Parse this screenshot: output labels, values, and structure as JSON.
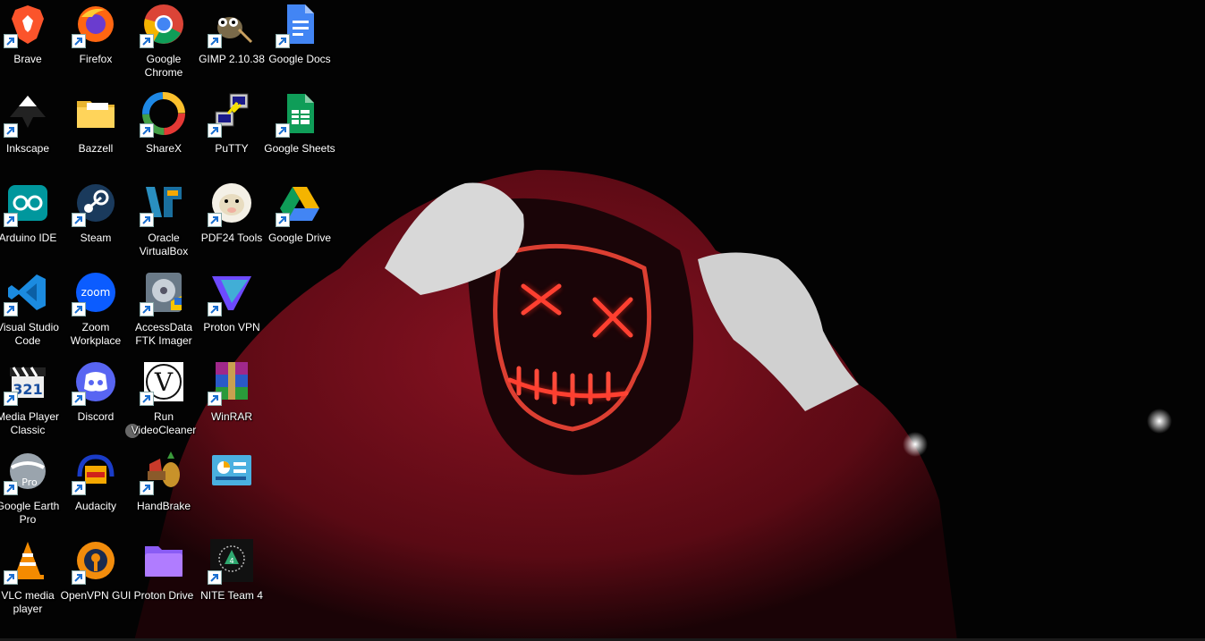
{
  "desktop": {
    "icons": [
      {
        "label": "Brave",
        "icon": "brave-icon",
        "shortcut": true
      },
      {
        "label": "Firefox",
        "icon": "firefox-icon",
        "shortcut": true
      },
      {
        "label": "Google Chrome",
        "icon": "chrome-icon",
        "shortcut": true
      },
      {
        "label": "GIMP 2.10.38",
        "icon": "gimp-icon",
        "shortcut": true
      },
      {
        "label": "Google Docs",
        "icon": "google-docs-icon",
        "shortcut": true
      },
      {
        "label": "Inkscape",
        "icon": "inkscape-icon",
        "shortcut": true
      },
      {
        "label": "Bazzell",
        "icon": "folder-icon",
        "shortcut": false
      },
      {
        "label": "ShareX",
        "icon": "sharex-icon",
        "shortcut": true
      },
      {
        "label": "PuTTY",
        "icon": "putty-icon",
        "shortcut": true
      },
      {
        "label": "Google Sheets",
        "icon": "google-sheets-icon",
        "shortcut": true
      },
      {
        "label": "Arduino IDE",
        "icon": "arduino-icon",
        "shortcut": true
      },
      {
        "label": "Steam",
        "icon": "steam-icon",
        "shortcut": true
      },
      {
        "label": "Oracle VirtualBox",
        "icon": "virtualbox-icon",
        "shortcut": true
      },
      {
        "label": "PDF24 Tools",
        "icon": "pdf24-icon",
        "shortcut": true
      },
      {
        "label": "Google Drive",
        "icon": "google-drive-icon",
        "shortcut": true
      },
      {
        "label": "Visual Studio Code",
        "icon": "vscode-icon",
        "shortcut": true
      },
      {
        "label": "Zoom Workplace",
        "icon": "zoom-icon",
        "shortcut": true
      },
      {
        "label": "AccessData FTK Imager",
        "icon": "ftk-imager-icon",
        "shortcut": true
      },
      {
        "label": "Proton VPN",
        "icon": "proton-vpn-icon",
        "shortcut": true
      },
      {
        "label": "Media Player Classic",
        "icon": "media-player-classic-icon",
        "shortcut": true
      },
      {
        "label": "Discord",
        "icon": "discord-icon",
        "shortcut": true
      },
      {
        "label": "Run VideoCleaner",
        "icon": "videocleaner-icon",
        "shortcut": true
      },
      {
        "label": "WinRAR",
        "icon": "winrar-icon",
        "shortcut": true
      },
      {
        "label": "Google Earth Pro",
        "icon": "google-earth-icon",
        "shortcut": true
      },
      {
        "label": "Audacity",
        "icon": "audacity-icon",
        "shortcut": true
      },
      {
        "label": "HandBrake",
        "icon": "handbrake-icon",
        "shortcut": true
      },
      {
        "label": "",
        "icon": "control-panel-icon",
        "shortcut": false
      },
      {
        "label": "VLC media player",
        "icon": "vlc-icon",
        "shortcut": true
      },
      {
        "label": "OpenVPN GUI",
        "icon": "openvpn-icon",
        "shortcut": true
      },
      {
        "label": "Proton Drive",
        "icon": "proton-drive-folder-icon",
        "shortcut": false
      },
      {
        "label": "NITE Team 4",
        "icon": "nite-team-4-icon",
        "shortcut": true
      }
    ]
  },
  "wallpaper": {
    "description_icon": "neon-mask-hoodie-wallpaper",
    "accent": "#ff3b2f",
    "hoodie": "#7a0f1c"
  }
}
